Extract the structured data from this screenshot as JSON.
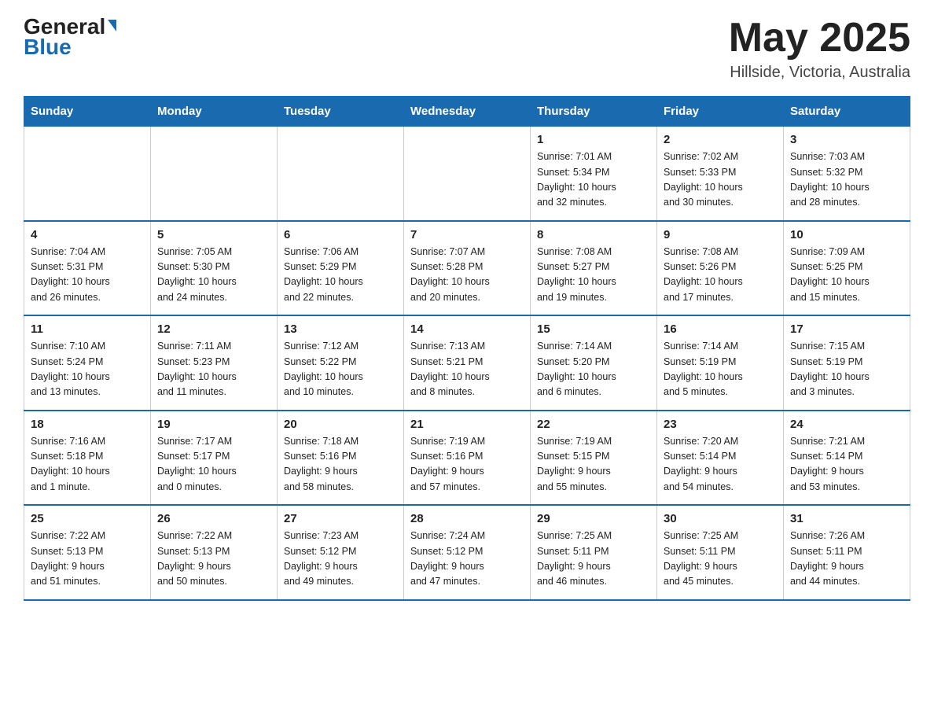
{
  "header": {
    "logo": {
      "general": "General",
      "triangle": "▶",
      "blue": "Blue"
    },
    "title": "May 2025",
    "location": "Hillside, Victoria, Australia"
  },
  "weekdays": [
    "Sunday",
    "Monday",
    "Tuesday",
    "Wednesday",
    "Thursday",
    "Friday",
    "Saturday"
  ],
  "weeks": [
    [
      {
        "day": "",
        "info": ""
      },
      {
        "day": "",
        "info": ""
      },
      {
        "day": "",
        "info": ""
      },
      {
        "day": "",
        "info": ""
      },
      {
        "day": "1",
        "info": "Sunrise: 7:01 AM\nSunset: 5:34 PM\nDaylight: 10 hours\nand 32 minutes."
      },
      {
        "day": "2",
        "info": "Sunrise: 7:02 AM\nSunset: 5:33 PM\nDaylight: 10 hours\nand 30 minutes."
      },
      {
        "day": "3",
        "info": "Sunrise: 7:03 AM\nSunset: 5:32 PM\nDaylight: 10 hours\nand 28 minutes."
      }
    ],
    [
      {
        "day": "4",
        "info": "Sunrise: 7:04 AM\nSunset: 5:31 PM\nDaylight: 10 hours\nand 26 minutes."
      },
      {
        "day": "5",
        "info": "Sunrise: 7:05 AM\nSunset: 5:30 PM\nDaylight: 10 hours\nand 24 minutes."
      },
      {
        "day": "6",
        "info": "Sunrise: 7:06 AM\nSunset: 5:29 PM\nDaylight: 10 hours\nand 22 minutes."
      },
      {
        "day": "7",
        "info": "Sunrise: 7:07 AM\nSunset: 5:28 PM\nDaylight: 10 hours\nand 20 minutes."
      },
      {
        "day": "8",
        "info": "Sunrise: 7:08 AM\nSunset: 5:27 PM\nDaylight: 10 hours\nand 19 minutes."
      },
      {
        "day": "9",
        "info": "Sunrise: 7:08 AM\nSunset: 5:26 PM\nDaylight: 10 hours\nand 17 minutes."
      },
      {
        "day": "10",
        "info": "Sunrise: 7:09 AM\nSunset: 5:25 PM\nDaylight: 10 hours\nand 15 minutes."
      }
    ],
    [
      {
        "day": "11",
        "info": "Sunrise: 7:10 AM\nSunset: 5:24 PM\nDaylight: 10 hours\nand 13 minutes."
      },
      {
        "day": "12",
        "info": "Sunrise: 7:11 AM\nSunset: 5:23 PM\nDaylight: 10 hours\nand 11 minutes."
      },
      {
        "day": "13",
        "info": "Sunrise: 7:12 AM\nSunset: 5:22 PM\nDaylight: 10 hours\nand 10 minutes."
      },
      {
        "day": "14",
        "info": "Sunrise: 7:13 AM\nSunset: 5:21 PM\nDaylight: 10 hours\nand 8 minutes."
      },
      {
        "day": "15",
        "info": "Sunrise: 7:14 AM\nSunset: 5:20 PM\nDaylight: 10 hours\nand 6 minutes."
      },
      {
        "day": "16",
        "info": "Sunrise: 7:14 AM\nSunset: 5:19 PM\nDaylight: 10 hours\nand 5 minutes."
      },
      {
        "day": "17",
        "info": "Sunrise: 7:15 AM\nSunset: 5:19 PM\nDaylight: 10 hours\nand 3 minutes."
      }
    ],
    [
      {
        "day": "18",
        "info": "Sunrise: 7:16 AM\nSunset: 5:18 PM\nDaylight: 10 hours\nand 1 minute."
      },
      {
        "day": "19",
        "info": "Sunrise: 7:17 AM\nSunset: 5:17 PM\nDaylight: 10 hours\nand 0 minutes."
      },
      {
        "day": "20",
        "info": "Sunrise: 7:18 AM\nSunset: 5:16 PM\nDaylight: 9 hours\nand 58 minutes."
      },
      {
        "day": "21",
        "info": "Sunrise: 7:19 AM\nSunset: 5:16 PM\nDaylight: 9 hours\nand 57 minutes."
      },
      {
        "day": "22",
        "info": "Sunrise: 7:19 AM\nSunset: 5:15 PM\nDaylight: 9 hours\nand 55 minutes."
      },
      {
        "day": "23",
        "info": "Sunrise: 7:20 AM\nSunset: 5:14 PM\nDaylight: 9 hours\nand 54 minutes."
      },
      {
        "day": "24",
        "info": "Sunrise: 7:21 AM\nSunset: 5:14 PM\nDaylight: 9 hours\nand 53 minutes."
      }
    ],
    [
      {
        "day": "25",
        "info": "Sunrise: 7:22 AM\nSunset: 5:13 PM\nDaylight: 9 hours\nand 51 minutes."
      },
      {
        "day": "26",
        "info": "Sunrise: 7:22 AM\nSunset: 5:13 PM\nDaylight: 9 hours\nand 50 minutes."
      },
      {
        "day": "27",
        "info": "Sunrise: 7:23 AM\nSunset: 5:12 PM\nDaylight: 9 hours\nand 49 minutes."
      },
      {
        "day": "28",
        "info": "Sunrise: 7:24 AM\nSunset: 5:12 PM\nDaylight: 9 hours\nand 47 minutes."
      },
      {
        "day": "29",
        "info": "Sunrise: 7:25 AM\nSunset: 5:11 PM\nDaylight: 9 hours\nand 46 minutes."
      },
      {
        "day": "30",
        "info": "Sunrise: 7:25 AM\nSunset: 5:11 PM\nDaylight: 9 hours\nand 45 minutes."
      },
      {
        "day": "31",
        "info": "Sunrise: 7:26 AM\nSunset: 5:11 PM\nDaylight: 9 hours\nand 44 minutes."
      }
    ]
  ]
}
